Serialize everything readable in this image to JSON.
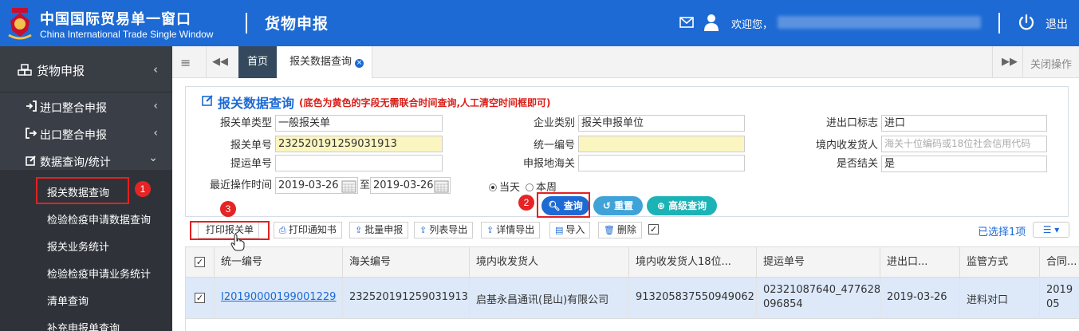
{
  "header": {
    "brand_cn": "中国国际贸易单一窗口",
    "brand_en": "China International Trade Single Window",
    "system_title": "货物申报",
    "welcome": "欢迎您，",
    "logout": "退出"
  },
  "sidebar": {
    "top_label": "货物申报",
    "top_chevron": "‹",
    "items": [
      {
        "label": "进口整合申报",
        "chevron": "‹"
      },
      {
        "label": "出口整合申报",
        "chevron": "‹"
      },
      {
        "label": "数据查询/统计",
        "chevron": "⌄"
      }
    ],
    "subitems": [
      "报关数据查询",
      "检验检疫申请数据查询",
      "报关业务统计",
      "检验检疫申请业务统计",
      "清单查询",
      "补充申报单查询"
    ]
  },
  "tabs": {
    "menu": "≡",
    "prev": "◀◀",
    "home": "首页",
    "active": "报关数据查询",
    "close_x": "×",
    "next": "▶▶",
    "close_ops": "关闭操作"
  },
  "query": {
    "title": "报关数据查询",
    "note": "(底色为黄色的字段无需联合时间查询,人工清空时间框即可)",
    "fields": {
      "decl_type": {
        "label": "报关单类型",
        "value": "一般报关单"
      },
      "decl_no": {
        "label": "报关单号",
        "value": "232520191259031913"
      },
      "bl_no": {
        "label": "提运单号",
        "value": ""
      },
      "recent_time": {
        "label": "最近操作时间",
        "from": "2019-03-26",
        "sep": "至",
        "to": "2019-03-26"
      },
      "ent_type": {
        "label": "企业类别",
        "value": "报关申报单位"
      },
      "unified_no": {
        "label": "统一编号",
        "value": ""
      },
      "customs": {
        "label": "申报地海关",
        "value": ""
      },
      "ie_flag": {
        "label": "进出口标志",
        "value": "进口"
      },
      "consignee": {
        "label": "境内收发货人",
        "placeholder": "海关十位编码或18位社会信用代码"
      },
      "closed": {
        "label": "是否结关",
        "value": "是"
      }
    },
    "radio_today": "当天",
    "radio_week": "本周",
    "btn_query": "查询",
    "btn_reset": "重置",
    "btn_advanced": "高级查询"
  },
  "toolbar": {
    "print_decl": "打印报关单",
    "print_notice": "打印通知书",
    "batch_submit": "批量申报",
    "list_export": "列表导出",
    "detail_export": "详情导出",
    "import": "导入",
    "delete": "删除",
    "selected": "已选择1项",
    "col_toggle": "☰ ▾"
  },
  "annotations": {
    "b1": "1",
    "b2": "2",
    "b3": "3"
  },
  "table": {
    "headers": [
      "统一编号",
      "海关编号",
      "境内收发货人",
      "境内收发货人18位...",
      "提运单号",
      "进出口...",
      "监管方式",
      "合同..."
    ],
    "row": {
      "unified_no": "I20190000199001229",
      "customs_no": "232520191259031913",
      "consignee": "启基永昌通讯(昆山)有限公司",
      "credit_code": "91320583755094906​2",
      "bl_line1": "02321087640_477628",
      "bl_line2": "096854",
      "ie_date": "2019-03-26",
      "supervision": "进料对口",
      "contract_line1": "2019",
      "contract_line2": "05"
    }
  },
  "colors": {
    "primary": "#1d6ad4",
    "sidebar": "#3a3f47",
    "highlight": "#e52020",
    "row_selected": "#dde9f9"
  }
}
